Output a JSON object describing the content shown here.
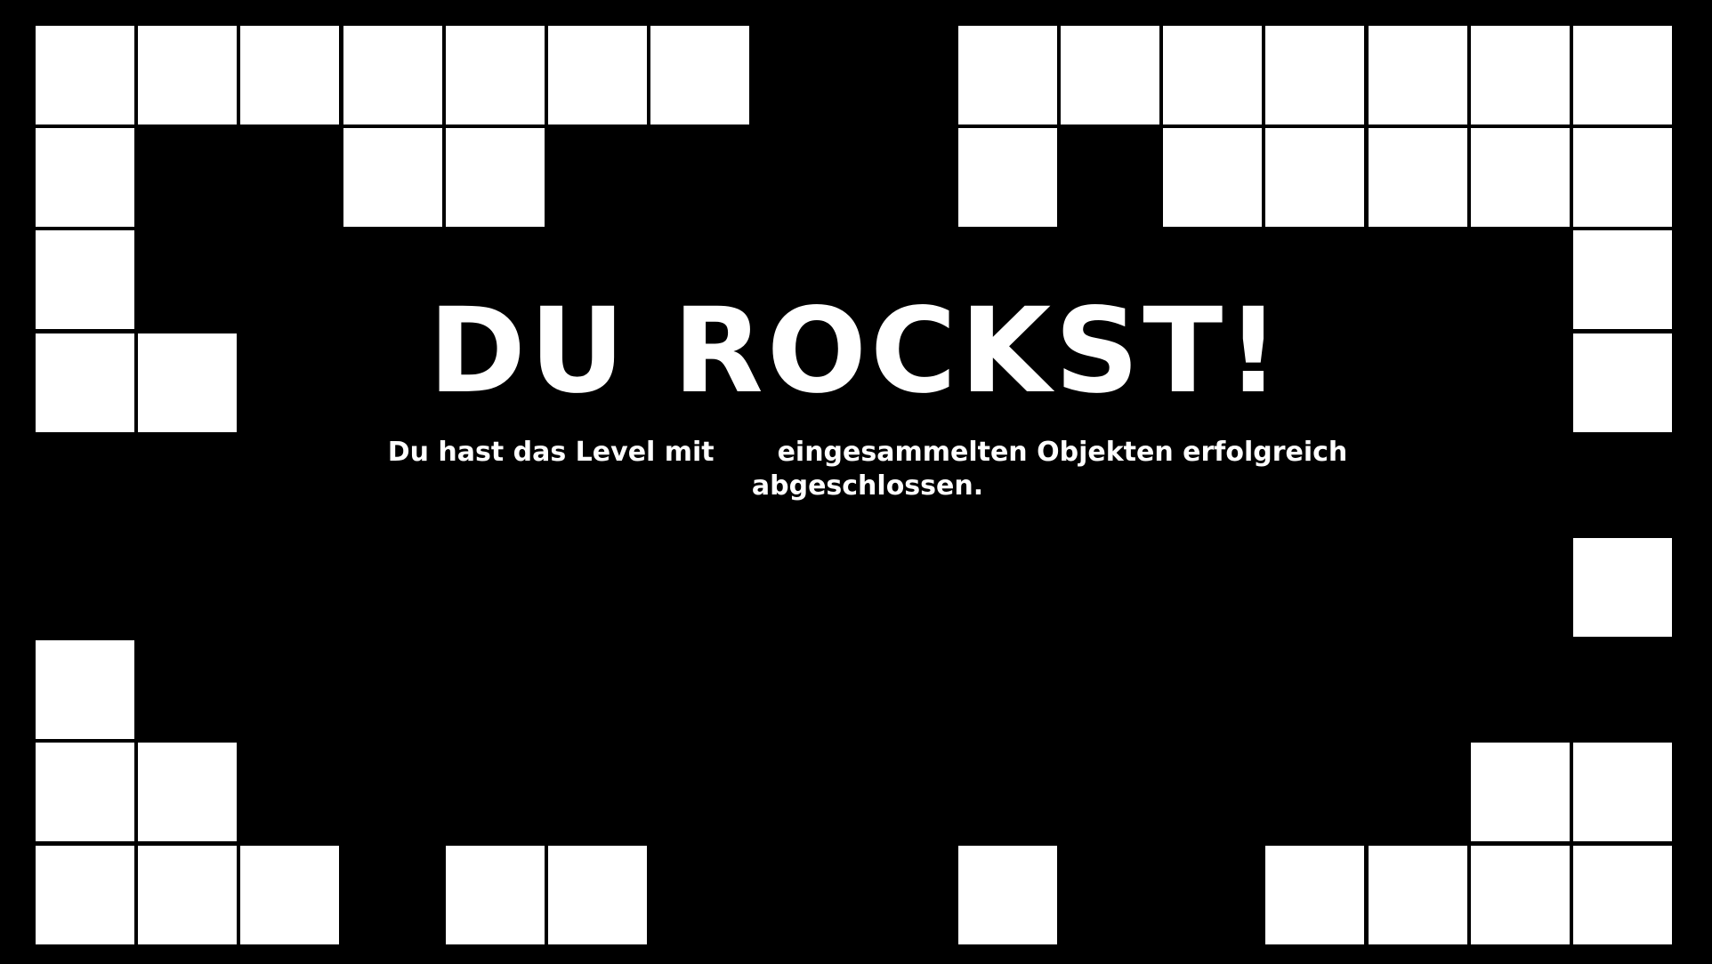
{
  "screen": {
    "title": "DU ROCKST!",
    "message_before": "Du hast das Level mit",
    "collected_count": "",
    "message_after": "eingesammelten Objekten erfolgreich abgeschlossen."
  },
  "colors": {
    "background": "#000000",
    "tile": "#ffffff",
    "text": "#ffffff"
  }
}
